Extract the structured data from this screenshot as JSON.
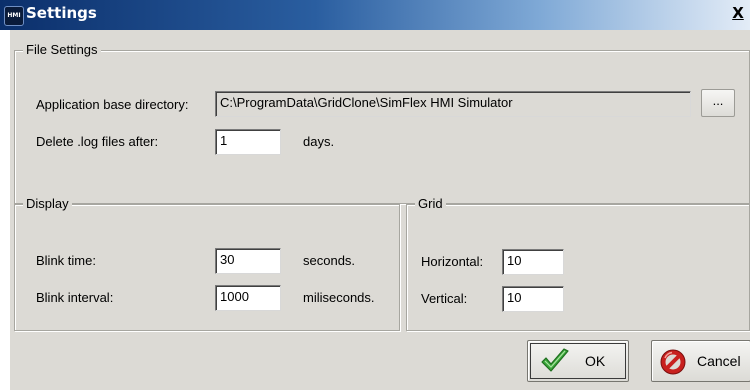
{
  "window": {
    "app_icon_text": "HMI",
    "title": "Settings",
    "close_label": "X"
  },
  "file_settings": {
    "legend": "File Settings",
    "base_dir_label": "Application base directory:",
    "base_dir_value": "C:\\ProgramData\\GridClone\\SimFlex HMI Simulator",
    "browse_label": "...",
    "delete_log_label": "Delete .log files after:",
    "delete_log_value": "1",
    "delete_log_unit": "days."
  },
  "display": {
    "legend": "Display",
    "blink_time_label": "Blink time:",
    "blink_time_value": "30",
    "blink_time_unit": "seconds.",
    "blink_interval_label": "Blink interval:",
    "blink_interval_value": "1000",
    "blink_interval_unit": "miliseconds."
  },
  "grid": {
    "legend": "Grid",
    "horizontal_label": "Horizontal:",
    "horizontal_value": "10",
    "vertical_label": "Vertical:",
    "vertical_value": "10"
  },
  "buttons": {
    "ok_label": "OK",
    "cancel_label": "Cancel"
  },
  "icons": {
    "ok": "checkmark-icon",
    "cancel": "prohibited-icon"
  },
  "colors": {
    "titlebar_start": "#0b2f6b",
    "titlebar_end": "#e3ecf7",
    "dialog_bg": "#dcdad5",
    "ok_check": "#3aa63a",
    "cancel_red": "#c8201e"
  }
}
